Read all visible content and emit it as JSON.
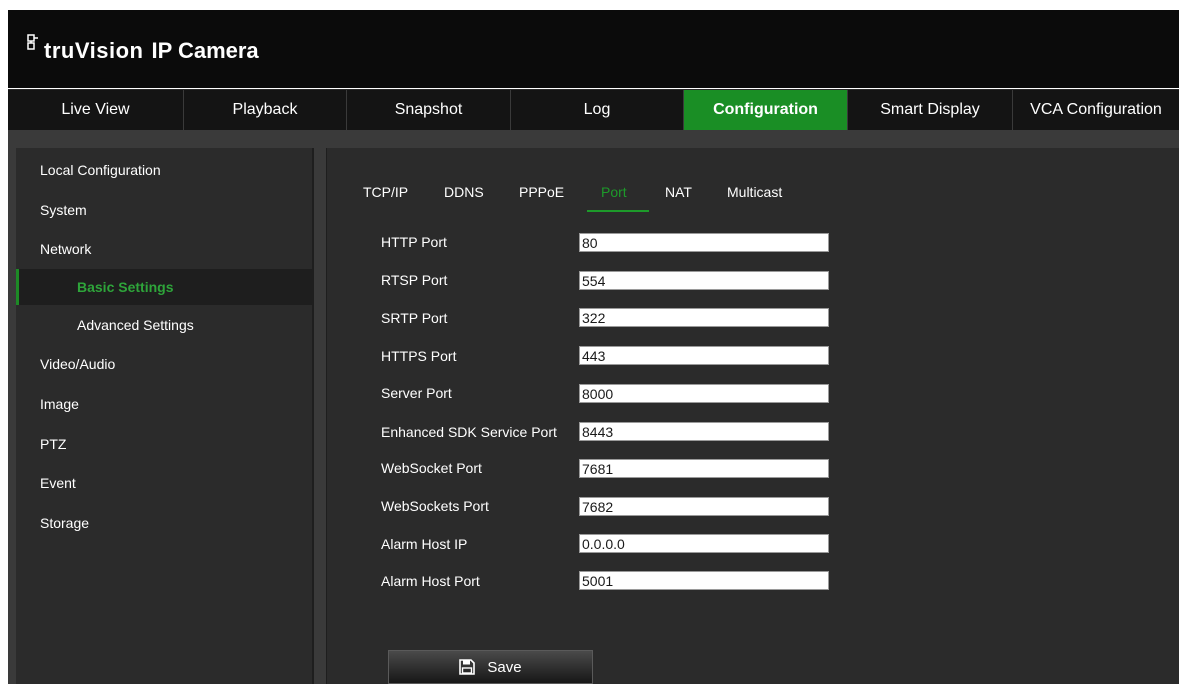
{
  "header": {
    "logo_brand": "truVision",
    "logo_product": "IP Camera"
  },
  "nav": {
    "tabs": [
      {
        "label": "Live View"
      },
      {
        "label": "Playback"
      },
      {
        "label": "Snapshot"
      },
      {
        "label": "Log"
      },
      {
        "label": "Configuration",
        "active": true
      },
      {
        "label": "Smart Display"
      },
      {
        "label": "VCA Configuration"
      }
    ]
  },
  "sidebar": {
    "items": [
      {
        "label": "Local Configuration",
        "level": 1
      },
      {
        "label": "System",
        "level": 1
      },
      {
        "label": "Network",
        "level": 1
      },
      {
        "label": "Basic Settings",
        "level": 2,
        "active": true
      },
      {
        "label": "Advanced Settings",
        "level": 2
      },
      {
        "label": "Video/Audio",
        "level": 1
      },
      {
        "label": "Image",
        "level": 1
      },
      {
        "label": "PTZ",
        "level": 1
      },
      {
        "label": "Event",
        "level": 1
      },
      {
        "label": "Storage",
        "level": 1
      }
    ]
  },
  "subtabs": [
    {
      "label": "TCP/IP"
    },
    {
      "label": "DDNS"
    },
    {
      "label": "PPPoE"
    },
    {
      "label": "Port",
      "active": true
    },
    {
      "label": "NAT"
    },
    {
      "label": "Multicast"
    }
  ],
  "fields": [
    {
      "label": "HTTP Port",
      "value": "80"
    },
    {
      "label": "RTSP Port",
      "value": "554"
    },
    {
      "label": "SRTP Port",
      "value": "322"
    },
    {
      "label": "HTTPS Port",
      "value": "443"
    },
    {
      "label": "Server Port",
      "value": "8000"
    },
    {
      "label": "Enhanced SDK Service Port",
      "value": "8443"
    },
    {
      "label": "WebSocket Port",
      "value": "7681"
    },
    {
      "label": "WebSockets Port",
      "value": "7682"
    },
    {
      "label": "Alarm Host IP",
      "value": "0.0.0.0"
    },
    {
      "label": "Alarm Host Port",
      "value": "5001"
    }
  ],
  "actions": {
    "save_label": "Save"
  },
  "icons": {
    "logo": "truvision-logo-icon",
    "save": "floppy-disk-icon"
  },
  "colors": {
    "accent": "#1a8e25",
    "active_text": "#2ea43a",
    "panel": "#2b2b2b",
    "header": "#0b0b0b"
  }
}
